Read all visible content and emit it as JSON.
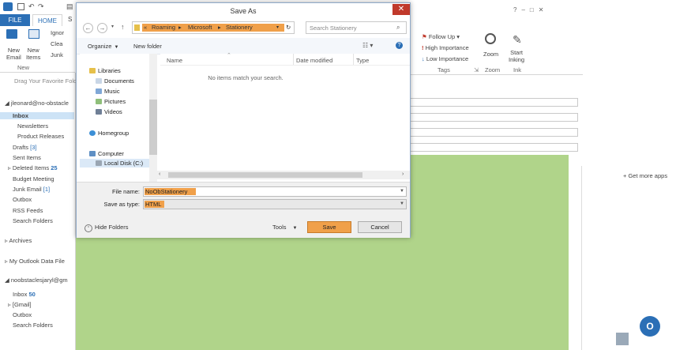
{
  "outlook": {
    "tabs": {
      "file": "FILE",
      "home": "HOME",
      "s": "S"
    },
    "ribbon": {
      "ignore": "Ignor",
      "clean": "Clea",
      "junk": "Junk",
      "new_email": [
        "New",
        "Email"
      ],
      "new_items": [
        "New",
        "Items"
      ],
      "new_group": "New",
      "follow_up": "Follow Up",
      "high_importance": "High Importance",
      "low_importance": "Low Importance",
      "zoom": "Zoom",
      "start_inking": [
        "Start",
        "Inking"
      ],
      "groups": {
        "tags": "Tags",
        "zoom": "Zoom",
        "ink": "Ink"
      }
    },
    "favorites_hint": "Drag Your Favorite Folde",
    "accounts": [
      {
        "name": "jleonard@no-obstacle",
        "folders": [
          {
            "label": "Inbox",
            "count": "",
            "bold": true
          },
          {
            "label": "Newsletters",
            "count": ""
          },
          {
            "label": "Product Releases",
            "count": ""
          },
          {
            "label": "Drafts",
            "count": "[3]"
          },
          {
            "label": "Sent Items",
            "count": ""
          },
          {
            "label": "Deleted Items",
            "count": "25"
          },
          {
            "label": "Budget Meeting",
            "count": ""
          },
          {
            "label": "Junk Email",
            "count": "[1]"
          },
          {
            "label": "Outbox",
            "count": ""
          },
          {
            "label": "RSS Feeds",
            "count": ""
          },
          {
            "label": "Search Folders",
            "count": ""
          }
        ]
      },
      {
        "name": "Archives"
      },
      {
        "name": "My Outlook Data File"
      },
      {
        "name": "noobstaclesjaryl@gm",
        "folders": [
          {
            "label": "Inbox",
            "count": "50"
          },
          {
            "label": "[Gmail]",
            "count": ""
          },
          {
            "label": "Outbox",
            "count": ""
          },
          {
            "label": "Search Folders",
            "count": ""
          }
        ]
      }
    ],
    "get_more_apps": "Get more apps",
    "window_controls": [
      "?",
      "–",
      "□",
      "✕"
    ]
  },
  "dialog": {
    "title": "Save As",
    "address": {
      "root": "«",
      "parts": [
        "Roaming",
        "Microsoft",
        "Stationery"
      ]
    },
    "search_placeholder": "Search Stationery",
    "toolbar": {
      "organize": "Organize",
      "new_folder": "New folder"
    },
    "tree": [
      {
        "label": "Libraries",
        "indent": 0
      },
      {
        "label": "Documents",
        "indent": 1
      },
      {
        "label": "Music",
        "indent": 1
      },
      {
        "label": "Pictures",
        "indent": 1
      },
      {
        "label": "Videos",
        "indent": 1
      },
      {
        "label": "Homegroup",
        "indent": 0
      },
      {
        "label": "Computer",
        "indent": 0
      },
      {
        "label": "Local Disk (C:)",
        "indent": 1
      }
    ],
    "columns": {
      "name": "Name",
      "date": "Date modified",
      "type": "Type"
    },
    "empty_message": "No items match your search.",
    "file_name_label": "File name:",
    "file_name_value": "NoObStationery",
    "save_type_label": "Save as type:",
    "save_type_value": "HTML",
    "hide_folders": "Hide Folders",
    "tools": "Tools",
    "save": "Save",
    "cancel": "Cancel"
  },
  "colors": {
    "accent": "#2b6fb6",
    "highlight": "#f0a04a",
    "stationery_green": "#b0d48a"
  }
}
